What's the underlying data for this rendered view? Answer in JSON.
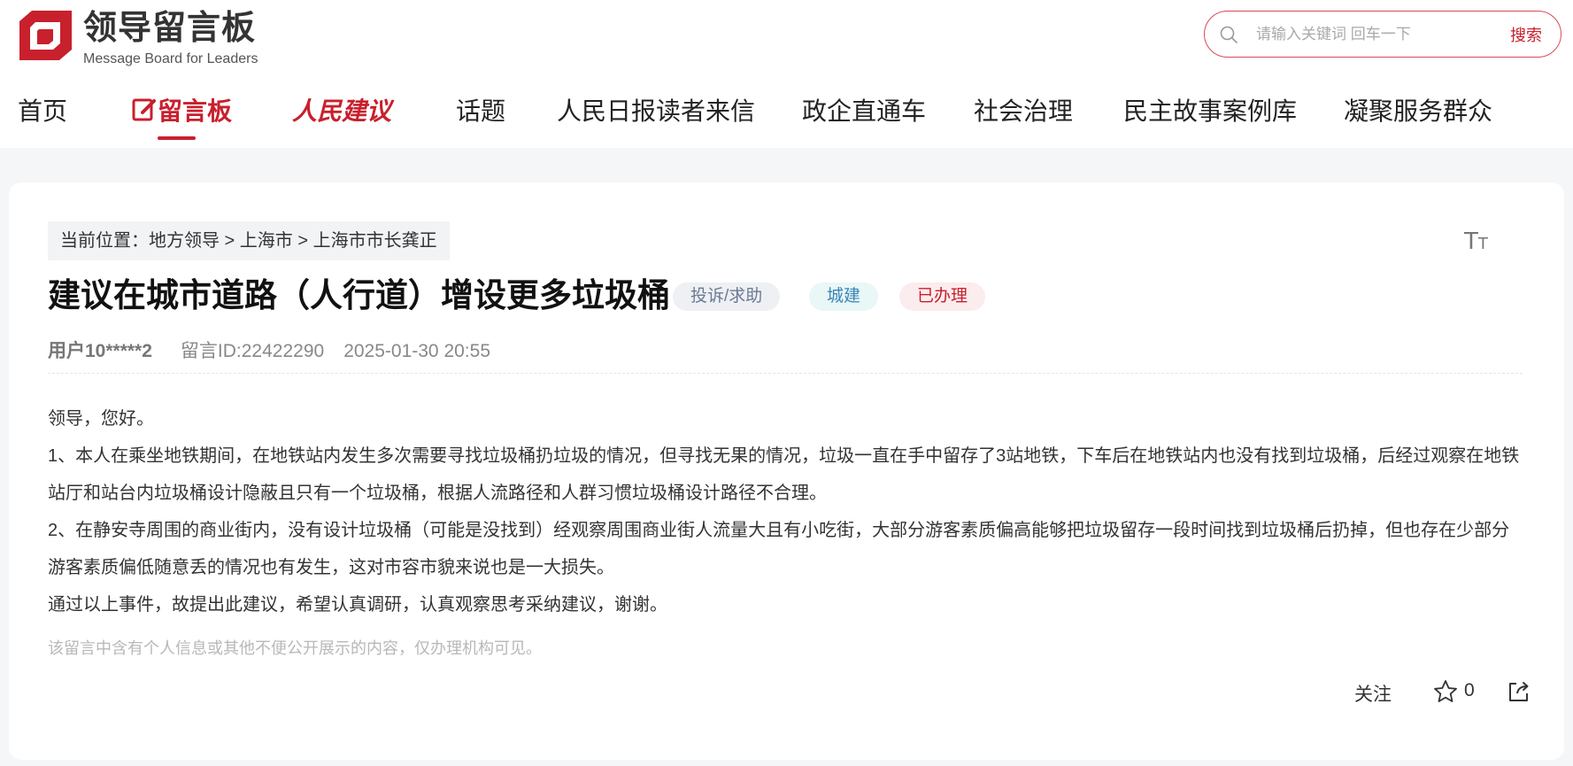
{
  "brand": {
    "name_cn": "领导留言板",
    "name_en": "Message Board for Leaders",
    "color": "#c8202d"
  },
  "search": {
    "placeholder": "请输入关键词 回车一下",
    "value": "",
    "button_label": "搜索"
  },
  "nav": {
    "items": [
      {
        "label": "首页"
      },
      {
        "label": "留言板",
        "active": true
      },
      {
        "label": "人民建议"
      },
      {
        "label": "话题"
      },
      {
        "label": "人民日报读者来信"
      },
      {
        "label": "政企直通车"
      },
      {
        "label": "社会治理"
      },
      {
        "label": "民主故事案例库"
      },
      {
        "label": "凝聚服务群众"
      }
    ]
  },
  "breadcrumb": "当前位置：地方领导 > 上海市 > 上海市市长龚正",
  "font_toggle_label": "TT",
  "post": {
    "title": "建议在城市道路（人行道）增设更多垃圾桶",
    "tags": {
      "type": "投诉/求助",
      "category": "城建",
      "status": "已办理"
    },
    "user": "用户10*****2",
    "message_id": "留言ID:22422290",
    "datetime": "2025-01-30 20:55",
    "paragraphs": [
      "领导，您好。",
      "1、本人在乘坐地铁期间，在地铁站内发生多次需要寻找垃圾桶扔垃圾的情况，但寻找无果的情况，垃圾一直在手中留存了3站地铁，下车后在地铁站内也没有找到垃圾桶，后经过观察在地铁站厅和站台内垃圾桶设计隐蔽且只有一个垃圾桶，根据人流路径和人群习惯垃圾桶设计路径不合理。",
      "2、在静安寺周围的商业街内，没有设计垃圾桶（可能是没找到）经观察周围商业街人流量大且有小吃街，大部分游客素质偏高能够把垃圾留存一段时间找到垃圾桶后扔掉，但也存在少部分游客素质偏低随意丢的情况也有发生，这对市容市貌来说也是一大损失。",
      "通过以上事件，故提出此建议，希望认真调研，认真观察思考采纳建议，谢谢。"
    ],
    "privacy_note": "该留言中含有个人信息或其他不便公开展示的内容，仅办理机构可见。"
  },
  "actions": {
    "follow_label": "关注",
    "star_count": "0"
  }
}
